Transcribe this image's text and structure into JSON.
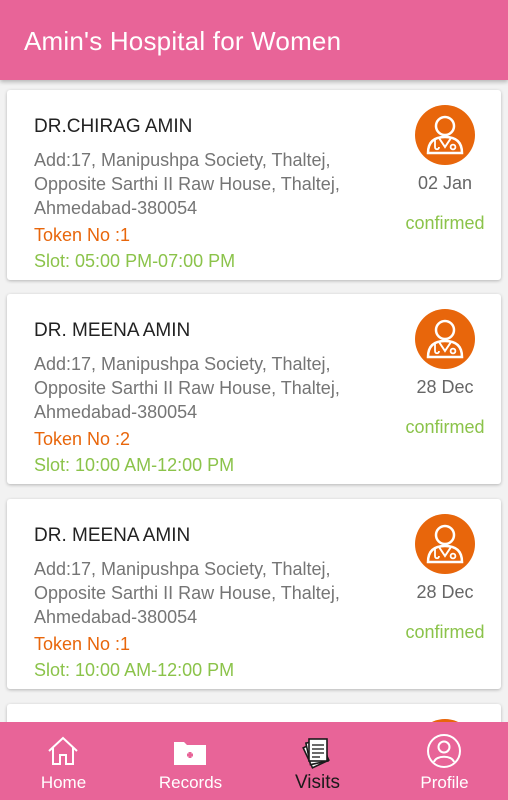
{
  "header": {
    "title": "Amin's Hospital for Women"
  },
  "visits": [
    {
      "doctor": "DR.CHIRAG AMIN",
      "address": "Add:17, Manipushpa Society, Thaltej, Opposite Sarthi II Raw House, Thaltej, Ahmedabad-380054",
      "token": "Token No :1",
      "slot": "Slot: 05:00 PM-07:00 PM",
      "date": "02 Jan",
      "status": "confirmed"
    },
    {
      "doctor": "DR. MEENA AMIN",
      "address": "Add:17, Manipushpa Society, Thaltej, Opposite Sarthi II Raw House, Thaltej, Ahmedabad-380054",
      "token": "Token No :2",
      "slot": "Slot: 10:00 AM-12:00 PM",
      "date": "28 Dec",
      "status": "confirmed"
    },
    {
      "doctor": "DR. MEENA AMIN",
      "address": "Add:17, Manipushpa Society, Thaltej, Opposite Sarthi II Raw House, Thaltej, Ahmedabad-380054",
      "token": "Token No :1",
      "slot": "Slot: 10:00 AM-12:00 PM",
      "date": "28 Dec",
      "status": "confirmed"
    }
  ],
  "nav": {
    "items": [
      {
        "label": "Home",
        "icon": "home-icon"
      },
      {
        "label": "Records",
        "icon": "medical-folder-icon"
      },
      {
        "label": "Visits",
        "icon": "documents-stack-icon",
        "active": true
      },
      {
        "label": "Profile",
        "icon": "profile-icon"
      }
    ]
  },
  "colors": {
    "primary": "#e86498",
    "token": "#e8660b",
    "success": "#8bc34a",
    "avatar_bg": "#e8660b"
  }
}
